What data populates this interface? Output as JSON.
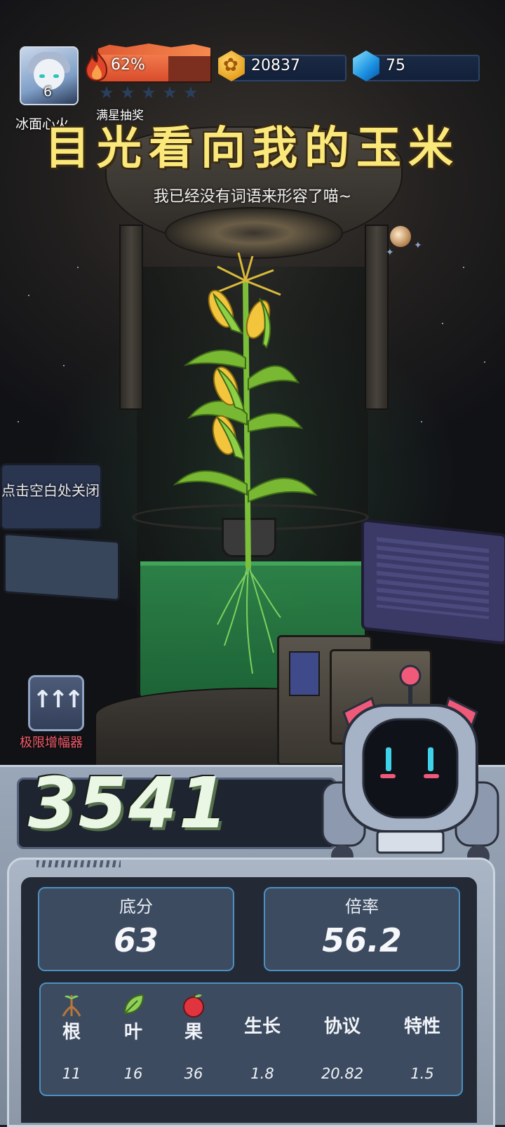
{
  "player": {
    "name": "冰面心火",
    "level": "6"
  },
  "resources": {
    "fire_percent": "62%",
    "fire_fraction": 0.62,
    "star_rating_filled": 0,
    "star_rating_total": 5,
    "lottery_label": "满星抽奖",
    "coins": "20837",
    "gems": "75"
  },
  "headline": "目光看向我的玉米",
  "subline": "我已经没有词语来形容了喵~",
  "close_hint": "点击空白处关闭",
  "amplifier": {
    "label": "极限增幅器",
    "icon": "triple-up-arrow-icon"
  },
  "score": {
    "total": "3541"
  },
  "stats": {
    "base_label": "底分",
    "base_value": "63",
    "multiplier_label": "倍率",
    "multiplier_value": "56.2"
  },
  "details": [
    {
      "label": "根",
      "icon": "root-icon",
      "value": "11"
    },
    {
      "label": "叶",
      "icon": "leaf-icon",
      "value": "16"
    },
    {
      "label": "果",
      "icon": "fruit-icon",
      "value": "36"
    },
    {
      "label": "生长",
      "icon": "",
      "value": "1.8"
    },
    {
      "label": "协议",
      "icon": "",
      "value": "20.82"
    },
    {
      "label": "特性",
      "icon": "",
      "value": "1.5"
    }
  ],
  "colors": {
    "headline": "#fbe87a",
    "fire": "#e65a34",
    "accent_border": "#4c90c2",
    "amp_label": "#f25b6a"
  }
}
